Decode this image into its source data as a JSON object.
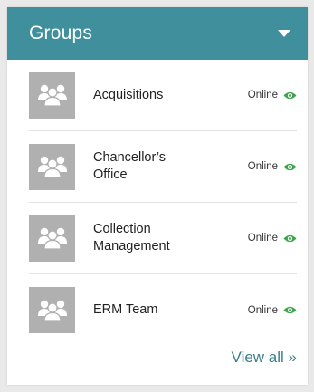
{
  "panel": {
    "title": "Groups",
    "toggle_icon": "caret-down-icon"
  },
  "groups": [
    {
      "name": "Acquisitions",
      "status": "Online",
      "icon": "group-users-icon"
    },
    {
      "name": "Chancellor’s Office",
      "status": "Online",
      "icon": "group-users-icon"
    },
    {
      "name": "Collection Management",
      "status": "Online",
      "icon": "group-users-icon"
    },
    {
      "name": "ERM Team",
      "status": "Online",
      "icon": "group-users-icon"
    }
  ],
  "footer": {
    "view_all": "View all »"
  },
  "colors": {
    "header_bg": "#3f8f9d",
    "online_eye": "#3fa34d",
    "link": "#3b7f8c"
  }
}
